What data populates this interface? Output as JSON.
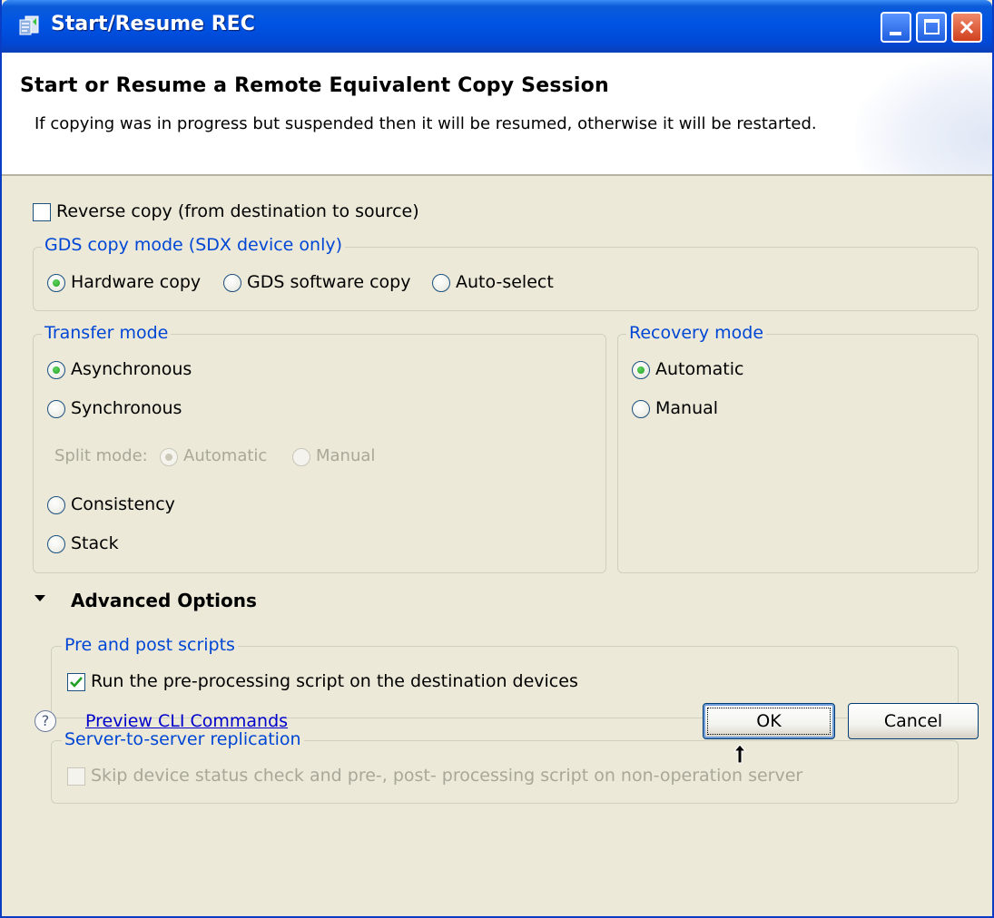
{
  "window": {
    "title": "Start/Resume REC"
  },
  "header": {
    "title": "Start or Resume a Remote Equivalent Copy Session",
    "description": "If copying was in progress but suspended then it will be resumed, otherwise it will be restarted."
  },
  "reverse_copy": {
    "label": "Reverse copy (from destination to source)",
    "checked": false
  },
  "gds_copy_mode": {
    "legend": "GDS copy mode (SDX device only)",
    "options": [
      {
        "label": "Hardware copy",
        "selected": true
      },
      {
        "label": "GDS software copy",
        "selected": false
      },
      {
        "label": "Auto-select",
        "selected": false
      }
    ]
  },
  "transfer_mode": {
    "legend": "Transfer mode",
    "options": [
      {
        "label": "Asynchronous",
        "selected": true
      },
      {
        "label": "Synchronous",
        "selected": false
      },
      {
        "label": "Consistency",
        "selected": false
      },
      {
        "label": "Stack",
        "selected": false
      }
    ],
    "split_mode": {
      "label": "Split mode:",
      "enabled": false,
      "options": [
        {
          "label": "Automatic",
          "selected": true
        },
        {
          "label": "Manual",
          "selected": false
        }
      ]
    }
  },
  "recovery_mode": {
    "legend": "Recovery mode",
    "options": [
      {
        "label": "Automatic",
        "selected": true
      },
      {
        "label": "Manual",
        "selected": false
      }
    ]
  },
  "advanced": {
    "title": "Advanced Options",
    "expanded": true,
    "pre_post_scripts": {
      "legend": "Pre and post scripts",
      "checkbox_label": "Run the pre-processing script on the destination devices",
      "checked": true
    },
    "server_replication": {
      "legend": "Server-to-server replication",
      "checkbox_label": "Skip device status check and pre-, post- processing script on non-operation server",
      "checked": false,
      "enabled": false
    }
  },
  "footer": {
    "help_icon": "question-icon",
    "preview_link": "Preview CLI Commands",
    "ok_label": "OK",
    "cancel_label": "Cancel"
  }
}
